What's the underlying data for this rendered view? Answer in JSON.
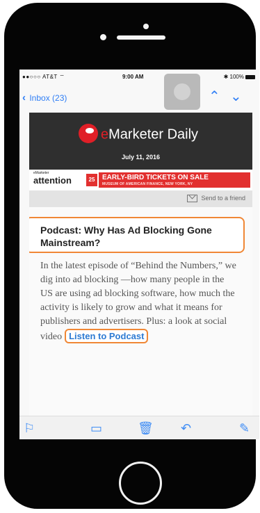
{
  "status": {
    "carrier": "AT&T",
    "time": "9:00 AM",
    "battery": "100%"
  },
  "nav": {
    "back_label": "Inbox (23)"
  },
  "email": {
    "brand_e": "e",
    "brand_name": "Marketer",
    "brand_suffix": " Daily",
    "date": "July 11, 2016",
    "ad": {
      "brand": "attention",
      "brand_small": "eMarketer",
      "date_badge": "25",
      "title": "EARLY-BIRD TICKETS ON SALE",
      "subtitle": "MUSEUM OF AMERICAN FINANCE, NEW YORK, NY"
    },
    "share_label": "Send to a friend",
    "headline": "Podcast: Why Has Ad Blocking Gone Mainstream?",
    "body_text": "In the latest episode of “Behind the Numbers,” we dig into ad blocking —how many people in the US are using ad blocking software, how much the activity is likely to grow and what it means for publishers and advertisers. Plus: a look at social video",
    "link_label": "Listen to Podcast"
  },
  "toolbar": {
    "flag_icon": "flag-icon",
    "folder_icon": "folder-icon",
    "trash_icon": "trash-icon",
    "reply_icon": "reply-icon",
    "compose_icon": "compose-icon"
  },
  "colors": {
    "accent": "#2f7ef5",
    "highlight": "#f08735",
    "brand_red": "#e01f27"
  }
}
